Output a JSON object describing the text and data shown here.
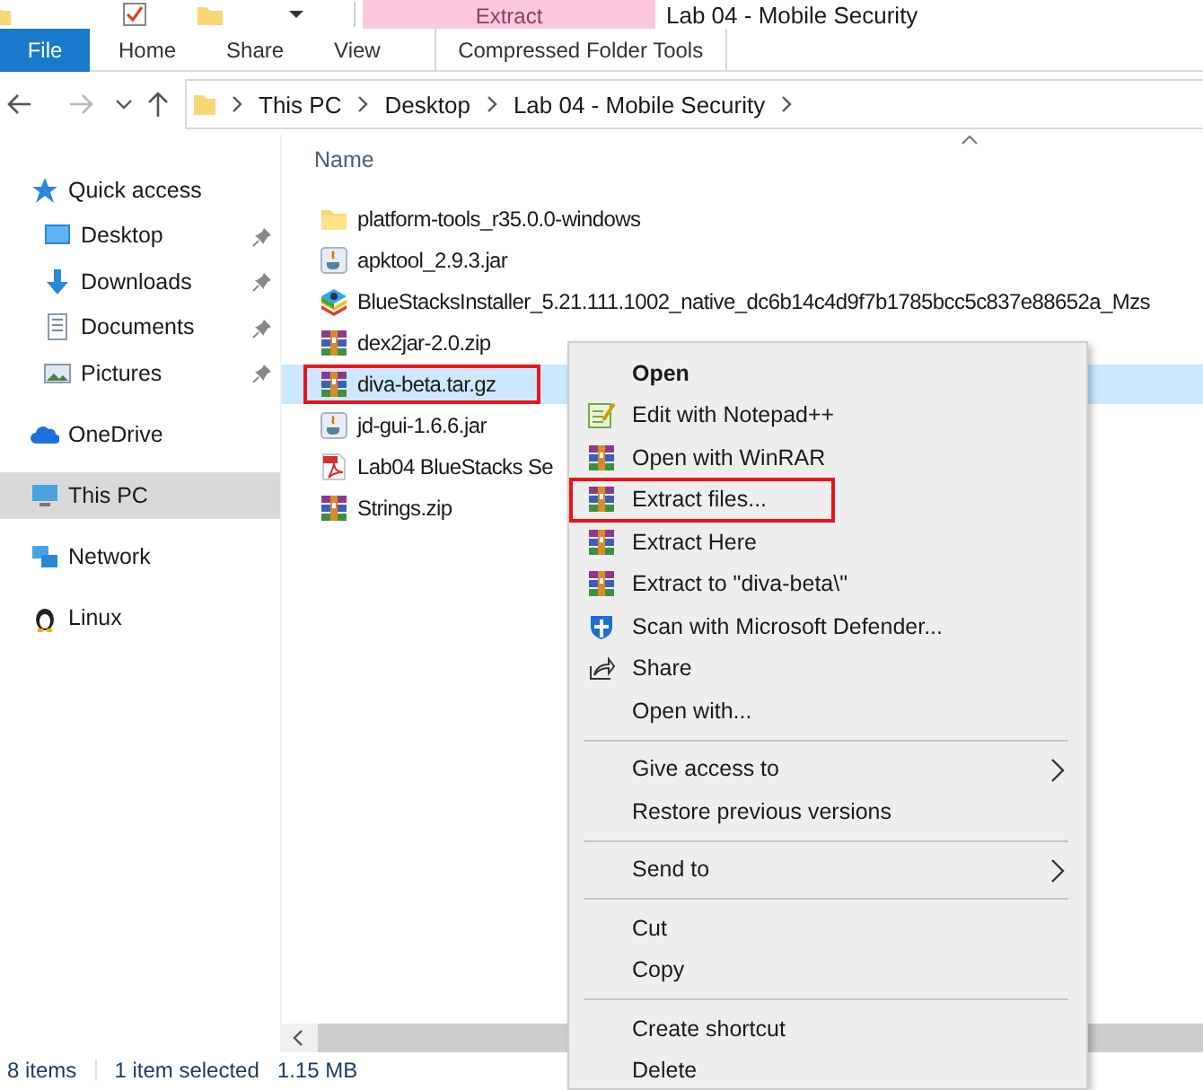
{
  "window": {
    "title": "Lab 04 - Mobile Security"
  },
  "ribbon": {
    "context_tab": "Extract",
    "tabs": [
      {
        "label": "File",
        "kind": "file"
      },
      {
        "label": "Home",
        "kind": "normal"
      },
      {
        "label": "Share",
        "kind": "normal"
      },
      {
        "label": "View",
        "kind": "normal"
      },
      {
        "label": "Compressed Folder Tools",
        "kind": "context"
      }
    ]
  },
  "navigation": {
    "back": {
      "disabled": false
    },
    "forward": {
      "disabled": true
    }
  },
  "address_bar": {
    "path": [
      "This PC",
      "Desktop",
      "Lab 04 - Mobile Security"
    ]
  },
  "sidebar": {
    "items": [
      {
        "label": "Quick access",
        "kind": "star",
        "selected": false,
        "children": [
          {
            "label": "Desktop",
            "kind": "desktop",
            "pinned": true,
            "selected": false
          },
          {
            "label": "Downloads",
            "kind": "downloads",
            "pinned": true,
            "selected": false
          },
          {
            "label": "Documents",
            "kind": "documents",
            "pinned": true,
            "selected": false
          },
          {
            "label": "Pictures",
            "kind": "pictures",
            "pinned": true,
            "selected": false
          }
        ]
      },
      {
        "label": "OneDrive",
        "kind": "cloud",
        "selected": false
      },
      {
        "label": "This PC",
        "kind": "computer",
        "selected": true
      },
      {
        "label": "Network",
        "kind": "network",
        "selected": false
      },
      {
        "label": "Linux",
        "kind": "penguin",
        "selected": false
      }
    ]
  },
  "file_list": {
    "columns": [
      "Name"
    ],
    "files": [
      {
        "name": "platform-tools_r35.0.0-windows",
        "kind": "folder",
        "selected": false,
        "highlighted": false
      },
      {
        "name": "apktool_2.9.3.jar",
        "kind": "jar",
        "selected": false,
        "highlighted": false
      },
      {
        "name": "BlueStacksInstaller_5.21.111.1002_native_dc6b14c4d9f7b1785bcc5c837e88652a_Mzs",
        "kind": "installer",
        "selected": false,
        "highlighted": false
      },
      {
        "name": "dex2jar-2.0.zip",
        "kind": "archive",
        "selected": false,
        "highlighted": false
      },
      {
        "name": "diva-beta.tar.gz",
        "kind": "archive",
        "selected": true,
        "highlighted": true
      },
      {
        "name": "jd-gui-1.6.6.jar",
        "kind": "jar",
        "selected": false,
        "highlighted": false
      },
      {
        "name": "Lab04 BlueStacks Se",
        "kind": "pdf",
        "selected": false,
        "highlighted": false
      },
      {
        "name": "Strings.zip",
        "kind": "archive",
        "selected": false,
        "highlighted": false
      }
    ]
  },
  "context_menu": {
    "items": [
      {
        "label": "Open",
        "kind": "default",
        "highlighted": false
      },
      {
        "label": "Edit with Notepad++",
        "kind": "notepad",
        "highlighted": false
      },
      {
        "label": "Open with WinRAR",
        "kind": "archive",
        "highlighted": false
      },
      {
        "label": "Extract files...",
        "kind": "archive",
        "highlighted": true
      },
      {
        "label": "Extract Here",
        "kind": "archive",
        "highlighted": false
      },
      {
        "label": "Extract to \"diva-beta\\\"",
        "kind": "archive",
        "highlighted": false
      },
      {
        "label": "Scan with Microsoft Defender...",
        "kind": "shield",
        "highlighted": false
      },
      {
        "label": "Share",
        "kind": "share",
        "highlighted": false
      },
      {
        "label": "Open with...",
        "kind": "plain",
        "highlighted": false
      },
      {
        "kind": "separator"
      },
      {
        "label": "Give access to",
        "kind": "submenu",
        "highlighted": false
      },
      {
        "label": "Restore previous versions",
        "kind": "plain",
        "highlighted": false
      },
      {
        "kind": "separator"
      },
      {
        "label": "Send to",
        "kind": "submenu",
        "highlighted": false
      },
      {
        "kind": "separator"
      },
      {
        "label": "Cut",
        "kind": "plain",
        "highlighted": false
      },
      {
        "label": "Copy",
        "kind": "plain",
        "highlighted": false
      },
      {
        "kind": "separator"
      },
      {
        "label": "Create shortcut",
        "kind": "plain",
        "highlighted": false
      },
      {
        "label": "Delete",
        "kind": "plain",
        "highlighted": false
      }
    ]
  },
  "status_bar": {
    "items": [
      "8 items",
      "1 item selected",
      "1.15 MB"
    ]
  }
}
